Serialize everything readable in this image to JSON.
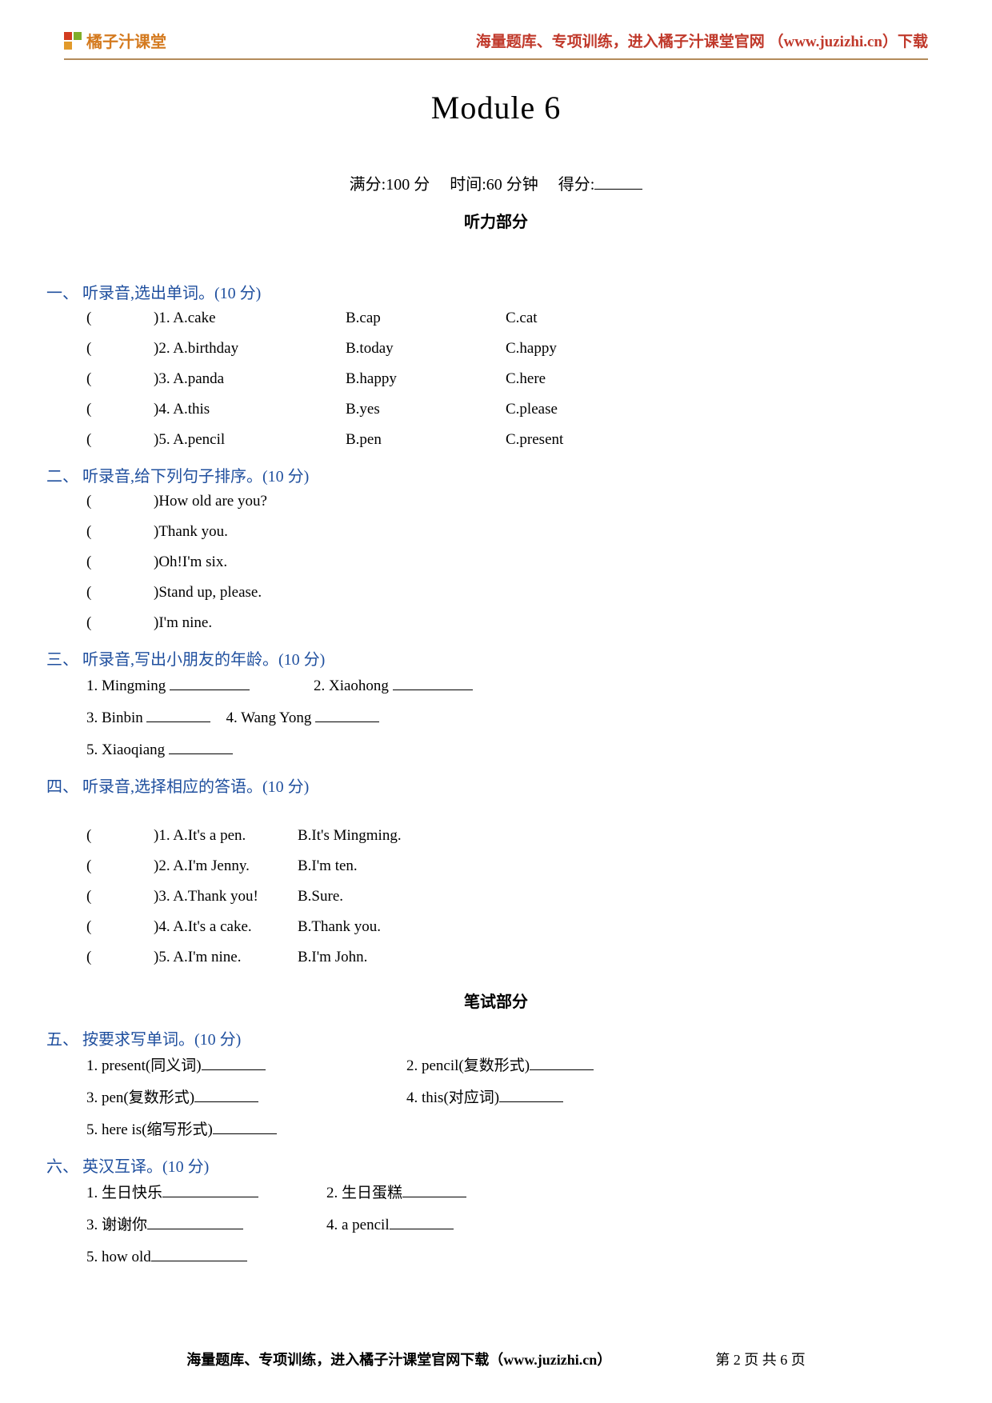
{
  "header": {
    "logo_text": "橘子汁课堂",
    "right_text": "海量题库、专项训练，进入橘子汁课堂官网 （www.juzizhi.cn）下载"
  },
  "title": "Module 6",
  "subinfo": {
    "full_label": "满分:",
    "full_value": "100 分",
    "time_label": "时间:",
    "time_value": "60 分钟",
    "score_label": "得分:"
  },
  "listening_label": "听力部分",
  "s1": {
    "heading": "一、 听录音,选出单词。(10 分)",
    "rows": [
      {
        "a": ")1. A.cake",
        "b": "B.cap",
        "c": "C.cat"
      },
      {
        "a": ")2. A.birthday",
        "b": "B.today",
        "c": "C.happy"
      },
      {
        "a": ")3. A.panda",
        "b": "B.happy",
        "c": "C.here"
      },
      {
        "a": ")4. A.this",
        "b": "B.yes",
        "c": "C.please"
      },
      {
        "a": ")5. A.pencil",
        "b": "B.pen",
        "c": "C.present"
      }
    ]
  },
  "s2": {
    "heading": "二、 听录音,给下列句子排序。(10 分)",
    "items": [
      ")How old are you?",
      ")Thank you.",
      ")Oh!I'm six.",
      ")Stand up, please.",
      ")I'm nine."
    ]
  },
  "s3": {
    "heading": "三、 听录音,写出小朋友的年龄。(10 分)",
    "r1a": "1. Mingming",
    "r1b": "2. Xiaohong",
    "r2a": "3. Binbin",
    "r2b": "4. Wang Yong",
    "r3a": "5. Xiaoqiang"
  },
  "s4": {
    "heading": "四、 听录音,选择相应的答语。(10 分)",
    "rows": [
      {
        "a": ")1. A.It's a pen.",
        "b": "B.It's Mingming."
      },
      {
        "a": ")2. A.I'm Jenny.",
        "b": "B.I'm ten."
      },
      {
        "a": ")3. A.Thank you!",
        "b": "B.Sure."
      },
      {
        "a": ")4. A.It's a cake.",
        "b": "B.Thank you."
      },
      {
        "a": ")5. A.I'm nine.",
        "b": "B.I'm John."
      }
    ]
  },
  "written_label": "笔试部分",
  "s5": {
    "heading": "五、 按要求写单词。(10 分)",
    "r1a": "1. present(同义词)",
    "r1b": "2. pencil(复数形式)",
    "r2a": "3. pen(复数形式)",
    "r2b": "4. this(对应词)",
    "r3a": "5. here is(缩写形式)"
  },
  "s6": {
    "heading": "六、 英汉互译。(10 分)",
    "r1a": "1.  生日快乐",
    "r1b": "2.  生日蛋糕",
    "r2a": "3.  谢谢你",
    "r2b": "4. a pencil",
    "r3a": "5. how old"
  },
  "footer": {
    "main": "海量题库、专项训练，进入橘子汁课堂官网下载（www.juzizhi.cn）",
    "pager": "第 2 页 共 6 页"
  }
}
